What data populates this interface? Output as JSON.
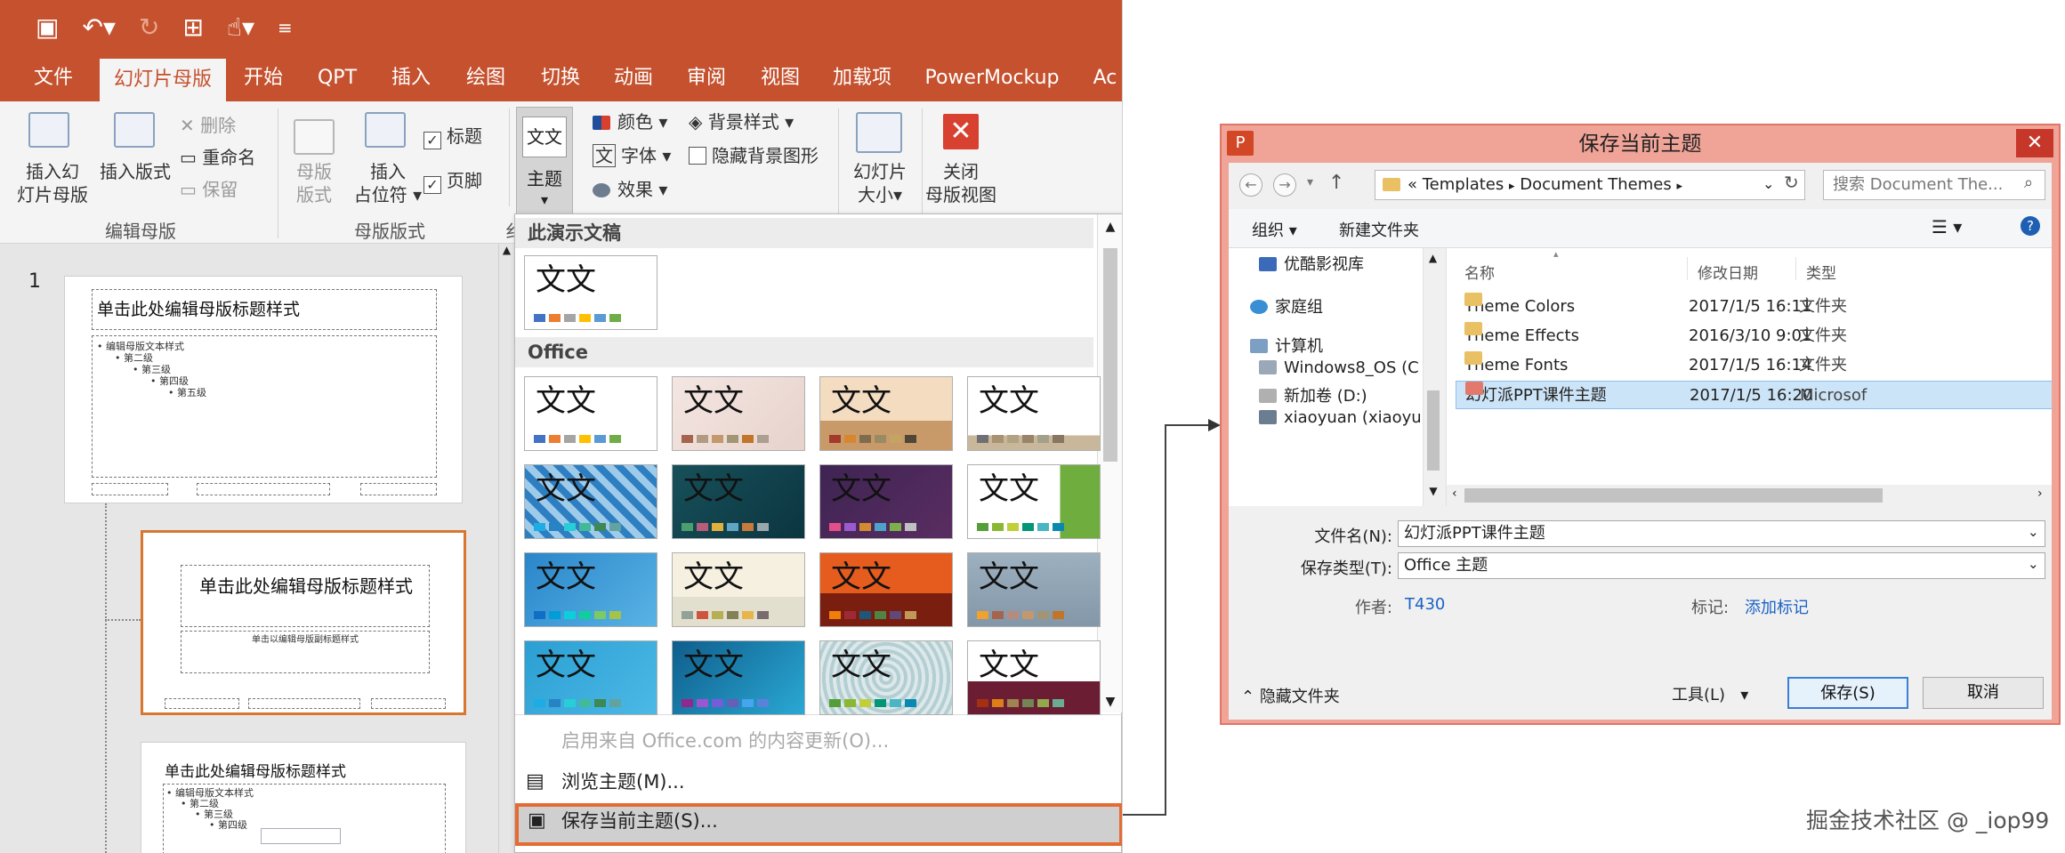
{
  "ppt": {
    "qat_icons": [
      "save-icon",
      "undo-icon",
      "redo-icon",
      "present-icon",
      "touch-mode-icon",
      "customize-icon"
    ],
    "tabs": [
      "文件",
      "幻灯片母版",
      "开始",
      "QPT",
      "插入",
      "绘图",
      "切换",
      "动画",
      "审阅",
      "视图",
      "加载项",
      "PowerMockup",
      "Ac"
    ],
    "ribbon": {
      "insert_master": [
        "插入幻",
        "灯片母版"
      ],
      "insert_layout": "插入版式",
      "delete": "删除",
      "rename": "重命名",
      "preserve": "保留",
      "group_edit": "编辑母版",
      "master_layout": [
        "母版",
        "版式"
      ],
      "insert_placeholder": [
        "插入",
        "占位符"
      ],
      "title_check": "标题",
      "footer_check": "页脚",
      "group_layout": "母版版式",
      "group_edit_theme_partial": "纟",
      "theme_icon_text": "文文",
      "theme": "主题",
      "colors": "颜色",
      "fonts": "字体",
      "effects": "效果",
      "bg_styles": "背景样式",
      "hide_bg": "隐藏背景图形",
      "slide_size": [
        "幻灯片",
        "大小"
      ],
      "close_master": [
        "关闭",
        "母版视图"
      ]
    },
    "slides": {
      "number": "1",
      "thumb1_title": "单击此处编辑母版标题样式",
      "thumb1_body": [
        "• 编辑母版文本样式",
        "• 第二级",
        "• 第三级",
        "• 第四级",
        "• 第五级"
      ],
      "thumb2_title": "单击此处编辑母版标题样式",
      "thumb2_sub": "单击以编辑母版副标题样式",
      "thumb3_title": "单击此处编辑母版标题样式",
      "thumb3_body": [
        "• 编辑母版文本样式",
        "• 第二级",
        "• 第三级",
        "• 第四级"
      ]
    },
    "gallery": {
      "section_current": "此演示文稿",
      "section_office": "Office",
      "theme_text": "文文",
      "menu_update": "启用来自 Office.com 的内容更新(O)...",
      "menu_browse": "浏览主题(M)...",
      "menu_save": "保存当前主题(S)..."
    }
  },
  "dialog": {
    "title": "保存当前主题",
    "app_icon": "P",
    "address": [
      "«",
      "Templates",
      "▸",
      "Document Themes",
      "▸"
    ],
    "search_placeholder": "搜索 Document The...",
    "toolbar_organize": "组织 ▾",
    "toolbar_new_folder": "新建文件夹",
    "nav": [
      "优酷影视库",
      "家庭组",
      "计算机",
      "Windows8_OS (C",
      "新加卷 (D:)",
      "xiaoyuan (xiaoyu"
    ],
    "columns": [
      "名称",
      "修改日期",
      "类型"
    ],
    "files": [
      {
        "name": "Theme Colors",
        "date": "2017/1/5 16:11",
        "type": "文件夹"
      },
      {
        "name": "Theme Effects",
        "date": "2016/3/10 9:01",
        "type": "文件夹"
      },
      {
        "name": "Theme Fonts",
        "date": "2017/1/5 16:14",
        "type": "文件夹"
      },
      {
        "name": "幻灯派PPT课件主题",
        "date": "2017/1/5 16:20",
        "type": "Microsof"
      }
    ],
    "filename_label": "文件名(N):",
    "filename_value": "幻灯派PPT课件主题",
    "filetype_label": "保存类型(T):",
    "filetype_value": "Office 主题",
    "author_label": "作者:",
    "author_value": "T430",
    "tags_label": "标记:",
    "tags_value": "添加标记",
    "hide_folders": "隐藏文件夹",
    "tools": "工具(L)",
    "save": "保存(S)",
    "cancel": "取消"
  },
  "watermark": "掘金技术社区 @ _iop99",
  "colors": {
    "ppt_orange": "#c5512e",
    "dialog_frame": "#f0a397",
    "highlight": "#e46c33",
    "selection": "#cce4f7"
  }
}
